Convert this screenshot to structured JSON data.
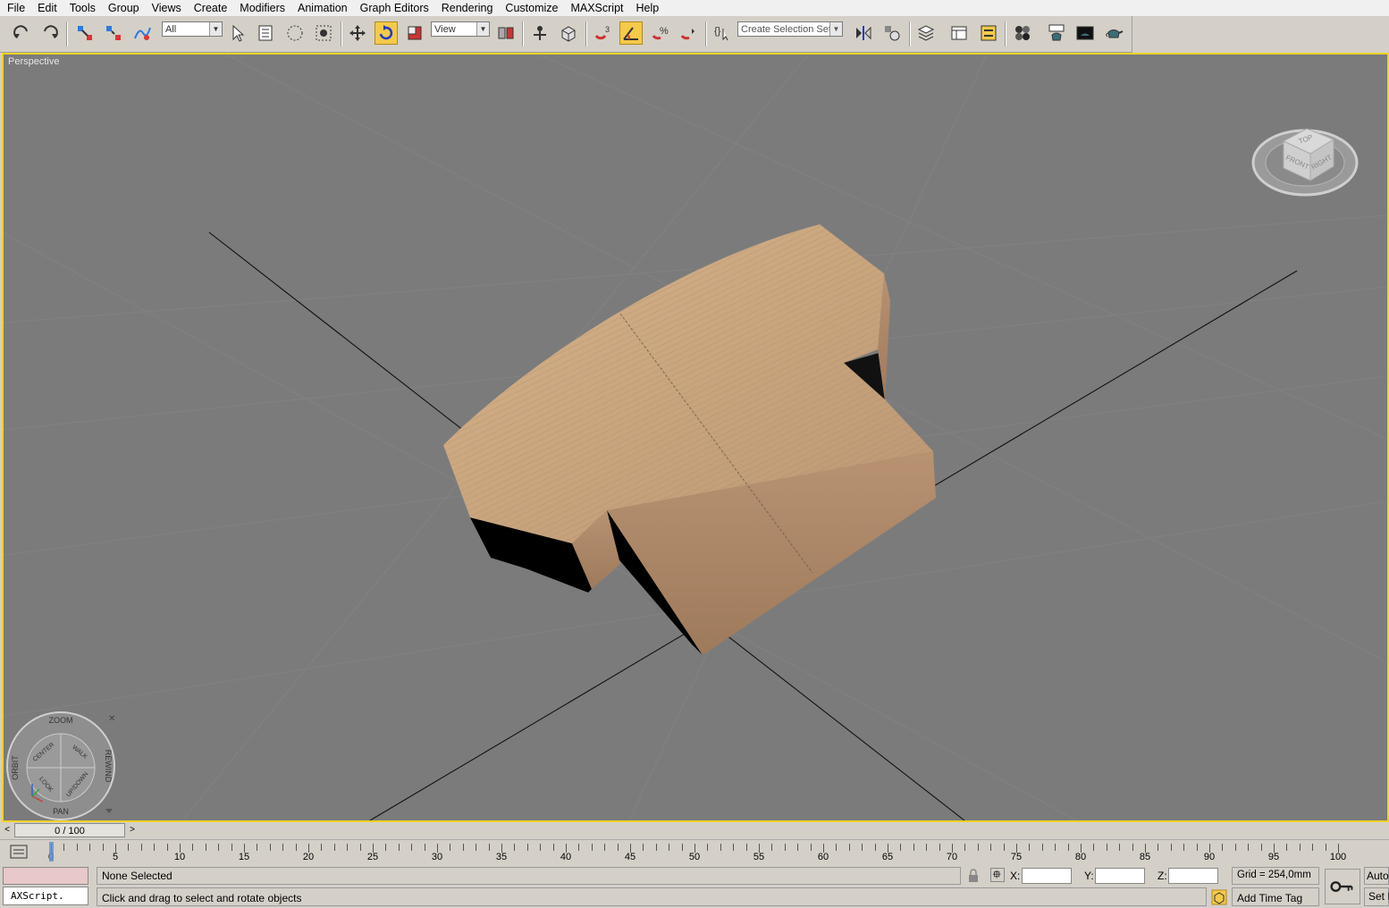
{
  "menu": [
    "File",
    "Edit",
    "Tools",
    "Group",
    "Views",
    "Create",
    "Modifiers",
    "Animation",
    "Graph Editors",
    "Rendering",
    "Customize",
    "MAXScript",
    "Help"
  ],
  "toolbar": {
    "selection_filter": "All",
    "ref_coord": "View",
    "selection_set_placeholder": "Create Selection Set",
    "snap_count": "3"
  },
  "viewport": {
    "label": "Perspective",
    "background": "#7b7b7b",
    "border": "#f0d226",
    "viewcube": {
      "top": "TOP",
      "front": "FRONT",
      "right": "RIGHT"
    },
    "steering_wheel": {
      "zoom": "ZOOM",
      "orbit": "ORBIT",
      "rewind": "REWIND",
      "pan": "PAN",
      "center": "CENTER",
      "walk": "WALK",
      "look": "LOOK",
      "updown": "UP/DOWN"
    }
  },
  "timeslider": {
    "position": "0 / 100",
    "prev": "<",
    "next": ">"
  },
  "trackbar": {
    "labels": [
      "0",
      "5",
      "10",
      "15",
      "20",
      "25",
      "30",
      "35",
      "40",
      "45",
      "50",
      "55",
      "60",
      "65",
      "70",
      "75",
      "80",
      "85",
      "90",
      "95",
      "100"
    ]
  },
  "status": {
    "maxscript_text": "AXScript.",
    "selection": "None Selected",
    "prompt": "Click and drag to select and rotate objects",
    "x_label": "X:",
    "y_label": "Y:",
    "z_label": "Z:",
    "grid": "Grid = 254,0mm",
    "add_time_tag": "Add Time Tag",
    "auto": "Auto",
    "set": "Set K"
  }
}
